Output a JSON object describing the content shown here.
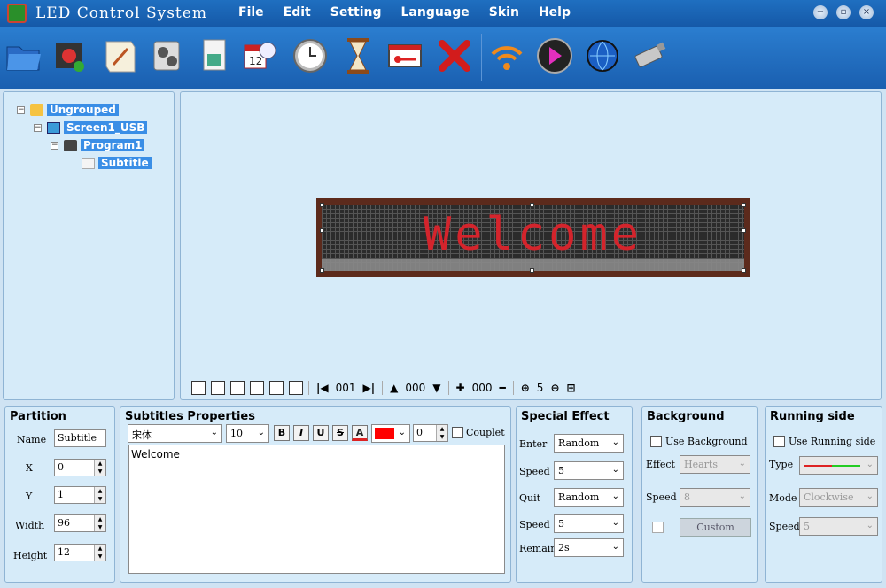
{
  "app": {
    "title": "LED Control System"
  },
  "menu": [
    "File",
    "Edit",
    "Setting",
    "Language",
    "Skin",
    "Help"
  ],
  "tree": {
    "group": "Ungrouped",
    "screen": "Screen1_USB",
    "program": "Program1",
    "item": "Subtitle"
  },
  "preview": {
    "text": "Welcome"
  },
  "controls": {
    "page": "001",
    "layer": "000",
    "zoom_offset": "000",
    "zoom": "5"
  },
  "partition": {
    "title": "Partition",
    "name_label": "Name",
    "name_value": "Subtitle",
    "x_label": "X",
    "x_value": "0",
    "y_label": "Y",
    "y_value": "1",
    "width_label": "Width",
    "width_value": "96",
    "height_label": "Height",
    "height_value": "12"
  },
  "subtitles": {
    "title": "Subtitles Properties",
    "font": "宋体",
    "size": "10",
    "bold": "B",
    "italic": "I",
    "underline": "U",
    "strike": "S",
    "color_btn": "A",
    "spacing": "0",
    "couplet_label": "Couplet",
    "text": "Welcome",
    "text_color": "#ff0000"
  },
  "effect": {
    "title": "Special Effect",
    "enter_label": "Enter",
    "enter_value": "Random",
    "speed1_label": "Speed",
    "speed1_value": "5",
    "quit_label": "Quit",
    "quit_value": "Random",
    "speed2_label": "Speed",
    "speed2_value": "5",
    "remain_label": "Remain",
    "remain_value": "2s"
  },
  "background": {
    "title": "Background",
    "use_label": "Use Background",
    "effect_label": "Effect",
    "effect_value": "Hearts",
    "speed_label": "Speed",
    "speed_value": "8",
    "custom_label": "Custom"
  },
  "running": {
    "title": "Running side",
    "use_label": "Use Running side",
    "type_label": "Type",
    "mode_label": "Mode",
    "mode_value": "Clockwise",
    "speed_label": "Speed",
    "speed_value": "5"
  },
  "icons": [
    "open-folder-icon",
    "new-program-icon",
    "subtitle-icon",
    "video-icon",
    "notebook-icon",
    "picture-icon",
    "calendar-clock-icon",
    "clock-icon",
    "timer-icon",
    "thermometer-icon",
    "delete-icon",
    "wifi-send-icon",
    "play-icon",
    "internet-icon",
    "usb-icon"
  ]
}
